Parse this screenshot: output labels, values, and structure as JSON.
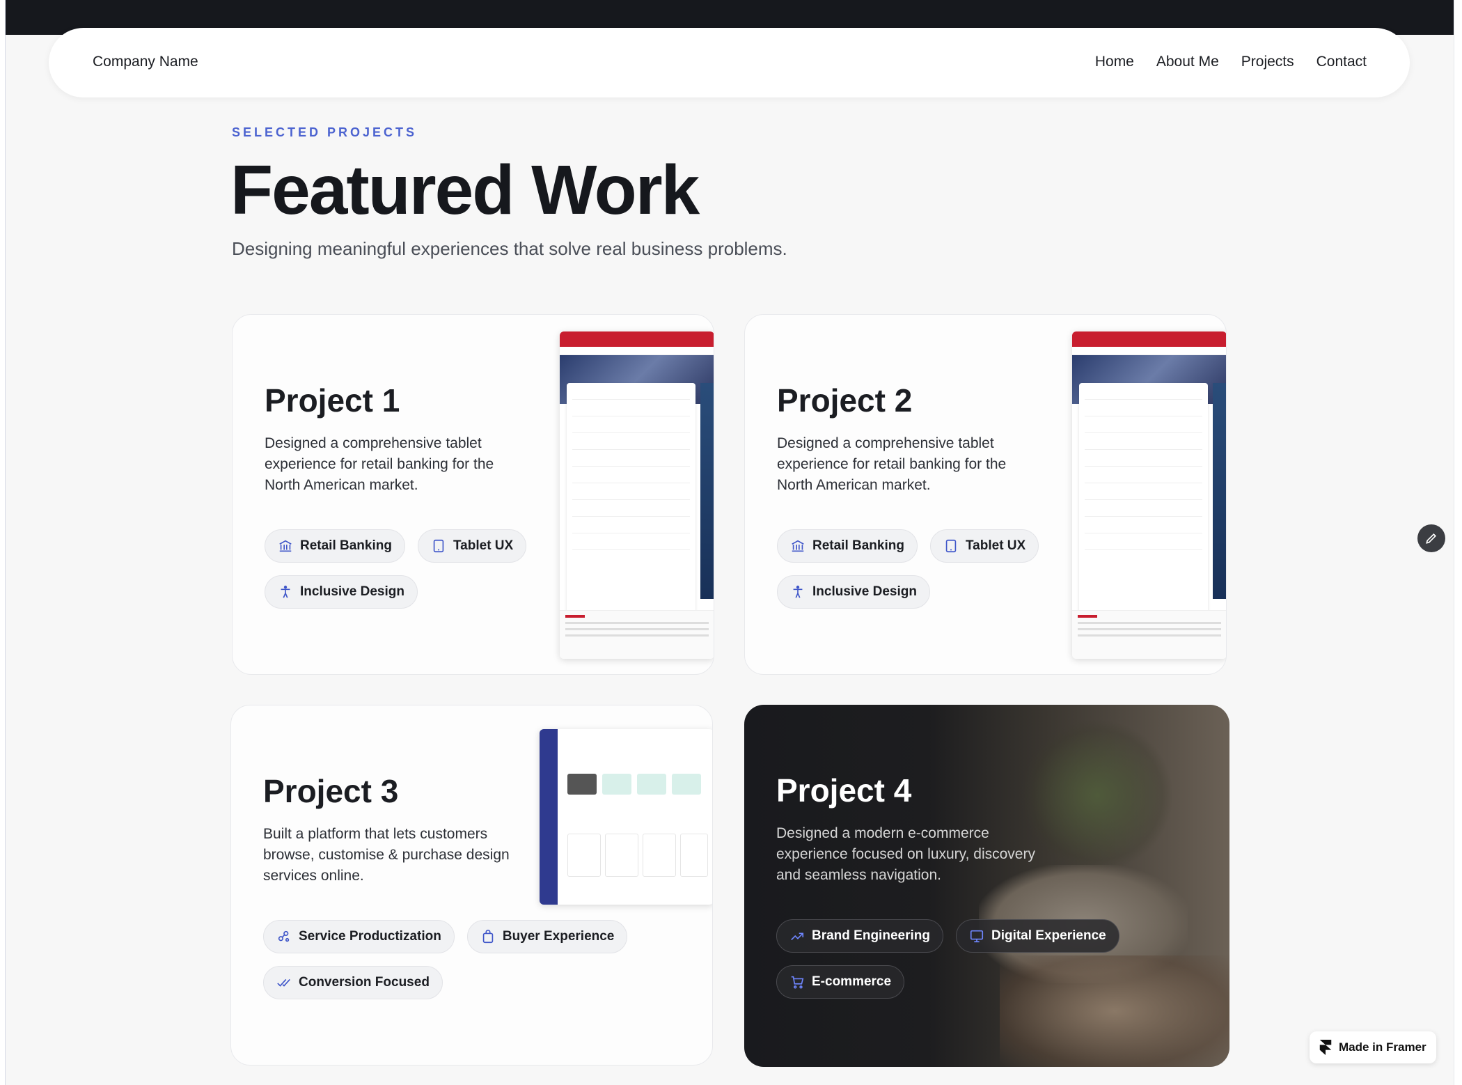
{
  "nav": {
    "brand": "Company Name",
    "links": [
      "Home",
      "About Me",
      "Projects",
      "Contact"
    ]
  },
  "hero": {
    "eyebrow": "SELECTED PROJECTS",
    "title": "Featured Work",
    "subtitle": "Designing meaningful experiences that solve real business problems."
  },
  "projects": [
    {
      "title": "Project 1",
      "description": "Designed a comprehensive tablet experience for retail banking for the North American market.",
      "tags": [
        {
          "label": "Retail Banking",
          "icon": "bank-icon"
        },
        {
          "label": "Tablet UX",
          "icon": "tablet-icon"
        },
        {
          "label": "Inclusive Design",
          "icon": "accessibility-icon"
        }
      ]
    },
    {
      "title": "Project 2",
      "description": "Designed a comprehensive tablet experience for retail banking for the North American market.",
      "tags": [
        {
          "label": "Retail Banking",
          "icon": "bank-icon"
        },
        {
          "label": "Tablet UX",
          "icon": "tablet-icon"
        },
        {
          "label": "Inclusive Design",
          "icon": "accessibility-icon"
        }
      ]
    },
    {
      "title": "Project 3",
      "description": "Built a platform that lets customers browse, customise & purchase design services online.",
      "tags": [
        {
          "label": "Service Productization",
          "icon": "network-icon"
        },
        {
          "label": "Buyer Experience",
          "icon": "shopping-bag-icon"
        },
        {
          "label": "Conversion Focused",
          "icon": "double-check-icon"
        }
      ]
    },
    {
      "title": "Project 4",
      "description": "Designed a modern e-commerce experience focused on luxury, discovery and seamless navigation.",
      "tags": [
        {
          "label": "Brand Engineering",
          "icon": "trend-icon"
        },
        {
          "label": "Digital Experience",
          "icon": "screen-icon"
        },
        {
          "label": "E-commerce",
          "icon": "cart-icon"
        }
      ]
    }
  ],
  "badge": {
    "label": "Made in Framer"
  },
  "colors": {
    "accent": "#4c63d0",
    "icon": "#3f56c9",
    "bank_red": "#c81e2f",
    "dark_card": "#1d1d1f"
  }
}
